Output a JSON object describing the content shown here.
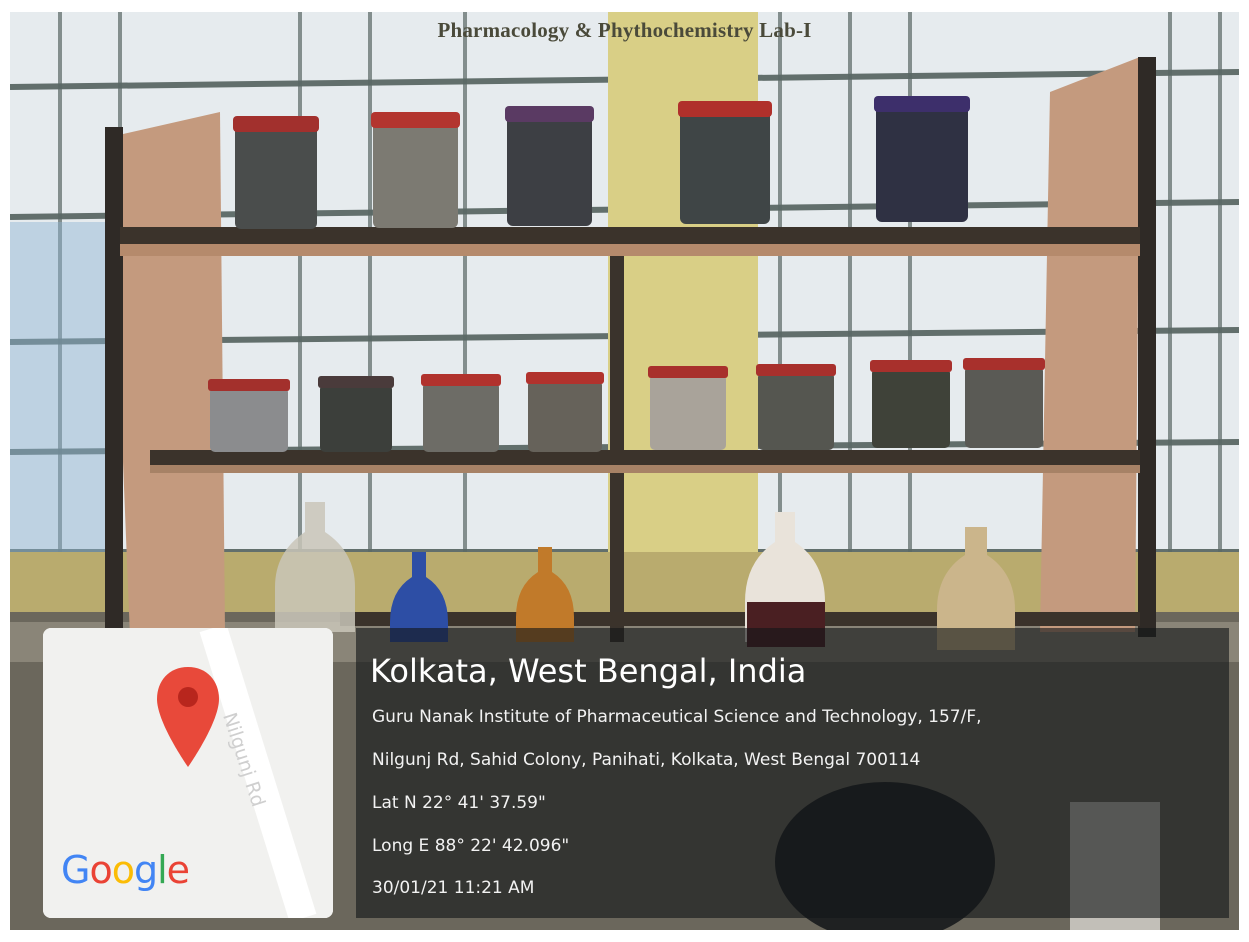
{
  "caption": "Pharmacology & Phythochemistry Lab-I",
  "map": {
    "road_label": "Nilgunj Rd",
    "brand_letters": [
      {
        "ch": "G",
        "color": "#4285F4"
      },
      {
        "ch": "o",
        "color": "#EA4335"
      },
      {
        "ch": "o",
        "color": "#FBBC05"
      },
      {
        "ch": "g",
        "color": "#4285F4"
      },
      {
        "ch": "l",
        "color": "#34A853"
      },
      {
        "ch": "e",
        "color": "#EA4335"
      }
    ],
    "pin_color": "#EA4335",
    "pin_icon": "map-pin-icon"
  },
  "location": {
    "title": "Kolkata, West Bengal, India",
    "address_line1": "Guru Nanak Institute of Pharmaceutical Science and Technology, 157/F,",
    "address_line2": "Nilgunj Rd, Sahid Colony, Panihati, Kolkata, West Bengal 700114",
    "latitude": "Lat N 22° 41' 37.59\"",
    "longitude": "Long E 88° 22' 42.096\"",
    "timestamp": "30/01/21 11:21 AM"
  }
}
